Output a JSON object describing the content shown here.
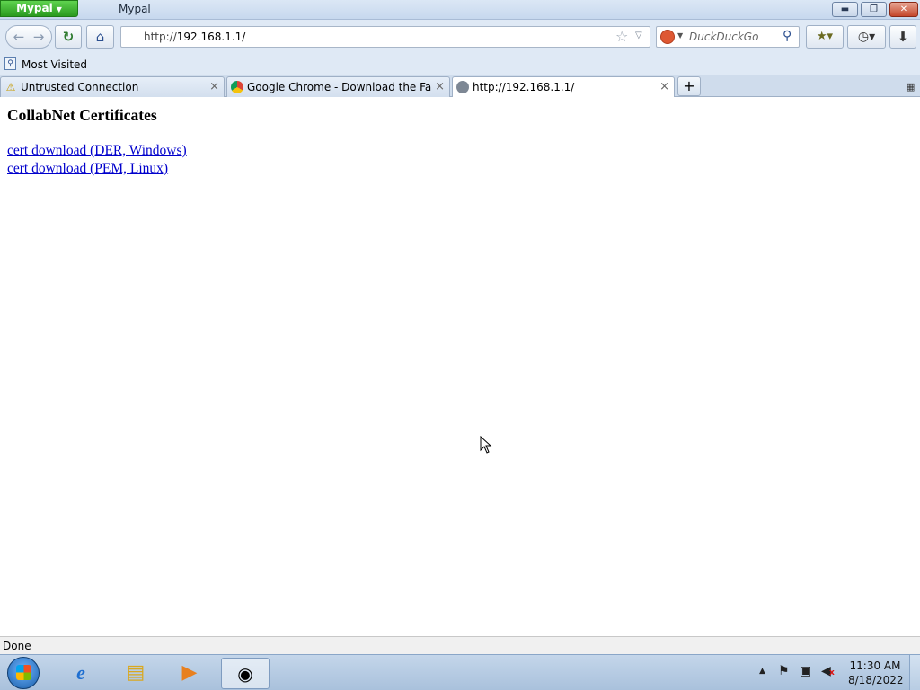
{
  "window": {
    "app_menu_label": "Mypal",
    "title": "Mypal",
    "minimize": "▬",
    "maximize": "❐",
    "close": "✕"
  },
  "navbar": {
    "url_scheme": "http://",
    "url_host": "192.168.1.1/",
    "search_placeholder": "DuckDuckGo",
    "icons": {
      "back": "←",
      "forward": "→",
      "reload": "↻",
      "home": "⌂",
      "star": "☆",
      "dropdown": "▽",
      "search": "⚲",
      "addon": "★▾",
      "history": "◷▾",
      "download": "⬇"
    }
  },
  "bookmarks": {
    "items": [
      {
        "label": "Most Visited"
      }
    ]
  },
  "tabs": [
    {
      "label": "Untrusted Connection",
      "icon": "warning-icon",
      "active": false
    },
    {
      "label": "Google Chrome - Download the Fast,...",
      "icon": "chrome-icon",
      "active": false
    },
    {
      "label": "http://192.168.1.1/",
      "icon": "globe-icon",
      "active": true
    }
  ],
  "tab_close_glyph": "×",
  "new_tab_glyph": "+",
  "page": {
    "heading": "CollabNet Certificates",
    "links": [
      {
        "label": "cert download (DER, Windows)"
      },
      {
        "label": "cert download (PEM, Linux)"
      }
    ]
  },
  "status": {
    "text": "Done"
  },
  "taskbar": {
    "pinned": [
      "internet-explorer-icon",
      "file-explorer-icon",
      "media-player-icon",
      "mypal-icon"
    ],
    "clock_time": "11:30 AM",
    "clock_date": "8/18/2022"
  },
  "colors": {
    "link": "#0000cc",
    "app_menu": "#2a9a1f",
    "close_button": "#c4472b"
  }
}
